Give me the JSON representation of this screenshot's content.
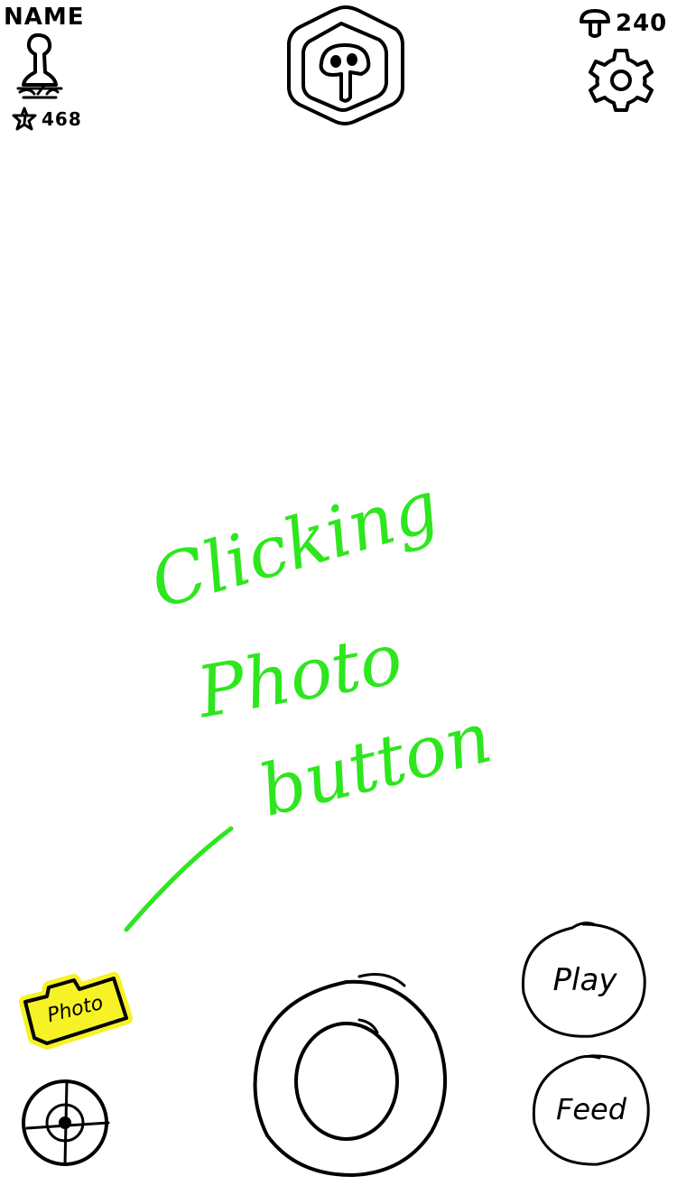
{
  "profile": {
    "name_label": "NAME",
    "stars_count": "468",
    "avatar_icon": "plunger-mushroom-avatar-icon",
    "star_icon": "star-icon"
  },
  "center_badge": {
    "icon": "mushroom-hexagon-badge-icon"
  },
  "currency": {
    "amount": "240",
    "icon": "mushroom-currency-icon"
  },
  "settings": {
    "icon": "gear-icon"
  },
  "bottom": {
    "photo_label": "Photo",
    "play_label": "Play",
    "feed_label": "Feed",
    "capture_icon": "capture-ring-icon",
    "target_icon": "crosshair-target-icon"
  },
  "annotation": {
    "line1": "Clicking",
    "line2": "Photo",
    "line3": "button",
    "color": "#2ee61e"
  },
  "highlight_color": "#f5f000"
}
